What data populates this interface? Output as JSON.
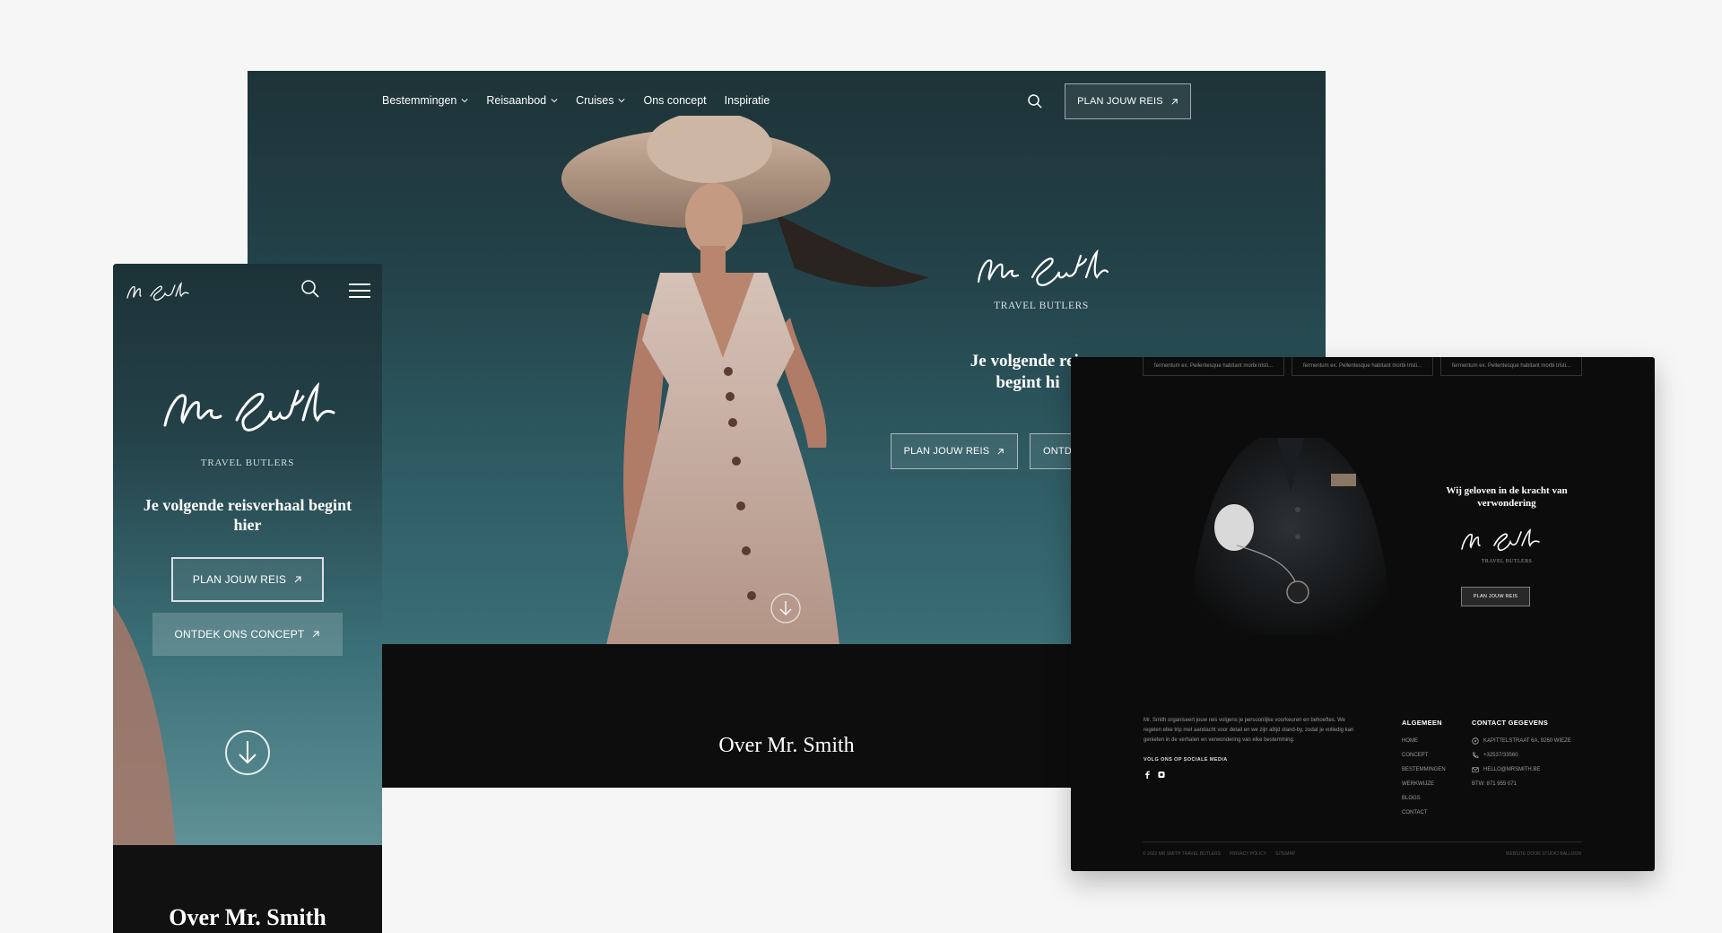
{
  "brand": {
    "logo_text": "Mr Smith",
    "tagline": "TRAVEL BUTLERS"
  },
  "desktop": {
    "nav": {
      "items": [
        {
          "label": "Bestemmingen",
          "has_dropdown": true
        },
        {
          "label": "Reisaanbod",
          "has_dropdown": true
        },
        {
          "label": "Cruises",
          "has_dropdown": true
        },
        {
          "label": "Ons concept",
          "has_dropdown": false
        },
        {
          "label": "Inspiratie",
          "has_dropdown": false
        }
      ],
      "search_icon": "search-icon",
      "cta_label": "PLAN JOUW REIS"
    },
    "hero": {
      "title_line1": "Je volgende reis",
      "title_line2": "begint hi",
      "btn_primary": "PLAN JOUW REIS",
      "btn_secondary": "ONTD"
    },
    "about_title": "Over Mr. Smith"
  },
  "mobile": {
    "hero_title": "Je volgende reisverhaal begint hier",
    "btn_primary": "PLAN JOUW REIS",
    "btn_secondary": "ONTDEK ONS CONCEPT",
    "about_title": "Over Mr. Smith"
  },
  "footer": {
    "tabs": [
      "fermentum ex. Pellentesque habitant morbi tristi...",
      "fermentum ex. Pellentesque habitant morbi tristi...",
      "fermentum ex. Pellentesque habitant morbi tristi..."
    ],
    "wij_geloven": "Wij geloven in de kracht van verwondering",
    "cta_label": "PLAN JOUW REIS",
    "about_text": "Mr. Smith organiseert jouw reis volgens je persoonlijke voorkeuren en behoeftes. We regelen elke trip met aandacht voor detail en we zijn altijd stand-by, zodat je volledig kan genieten in de verhalen en verwondering van elke bestemming.",
    "social_title": "VOLG ONS OP SOCIALE MEDIA",
    "col_algemeen": {
      "heading": "ALGEMEEN",
      "links": [
        "HOME",
        "CONCEPT",
        "BESTEMMINGEN",
        "WERKWIJZE",
        "BLOGS",
        "CONTACT"
      ]
    },
    "col_contact": {
      "heading": "CONTACT GEGEVENS",
      "rows": [
        {
          "icon": "location-icon",
          "text": "KAPITTELSTRAAT 6A, 9260 WIEZE"
        },
        {
          "icon": "phone-icon",
          "text": "+32537/33560"
        },
        {
          "icon": "mail-icon",
          "text": "HELLO@MRSMITH.BE"
        },
        {
          "icon": "",
          "text": "BTW: 871 955 071"
        }
      ]
    },
    "bottom_links": [
      "© 2023 MR SMITH TRAVEL BUTLERS",
      "PRIVACY POLICY",
      "SITEMAP"
    ],
    "credit": "WEBSITE DOOR STUDIO BALLOON"
  },
  "colors": {
    "page_bg": "#f6f6f6",
    "hero_teal": "#2f5c64",
    "dark": "#0c0c0c",
    "text_white": "#ffffff"
  }
}
